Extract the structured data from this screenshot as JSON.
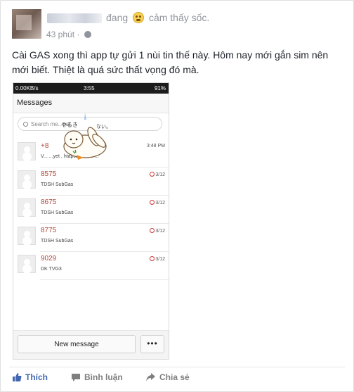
{
  "post": {
    "status_prefix": "đang",
    "feeling": "cảm thấy sốc.",
    "time": "43 phút",
    "time_dot": "·",
    "text": "Cài GAS xong thì app tự gửi 1 nùi tin thế này. Hôm nay mới gắn sim nên mới biết. Thiệt là quá sức thất vọng đó mà."
  },
  "phone": {
    "statusbar": {
      "left": "0.00KB/s",
      "time": "3:55",
      "battery": "91%"
    },
    "title": "Messages",
    "search_placeholder": "Search me...gat",
    "messages": [
      {
        "number": "+8",
        "snippet": "V... ...yet , htapche ex. 4 ...",
        "date": "3:48 PM"
      },
      {
        "number": "8575",
        "snippet": "TDSH SubGas",
        "date": "3/12"
      },
      {
        "number": "8675",
        "snippet": "TDSH SubGas",
        "date": "3/12"
      },
      {
        "number": "8775",
        "snippet": "TDSH SubGas",
        "date": "3/12"
      },
      {
        "number": "9029",
        "snippet": "DK TVG3",
        "date": "3/12"
      }
    ],
    "new_message": "New message",
    "more": "•••"
  },
  "actions": {
    "like": "Thích",
    "comment": "Bình luận",
    "share": "Chia sẻ"
  },
  "colors": {
    "link_blue": "#4267b2",
    "meta_gray": "#90949c",
    "sms_number": "#b0473a"
  }
}
